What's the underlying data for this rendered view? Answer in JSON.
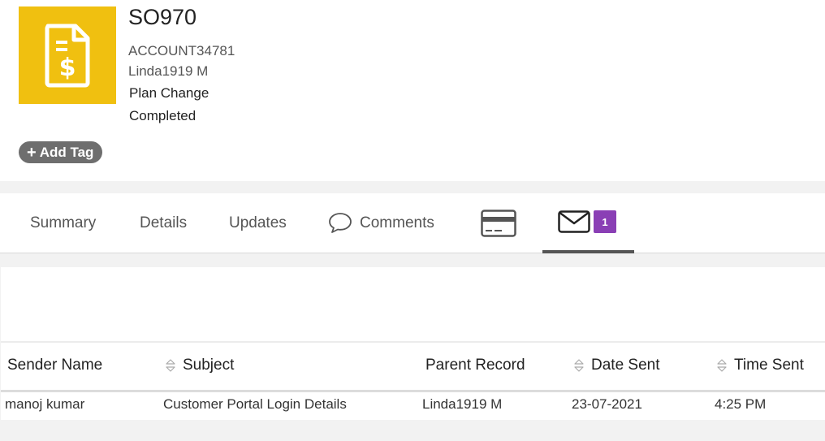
{
  "record": {
    "icon": "invoice-dollar-icon",
    "id": "SO970",
    "account": "ACCOUNT34781",
    "contact": "Linda1919 M",
    "type": "Plan Change",
    "status": "Completed",
    "add_tag_label": "Add Tag",
    "brand_color": "#f0c010"
  },
  "tabs": {
    "summary": "Summary",
    "details": "Details",
    "updates": "Updates",
    "comments": "Comments",
    "billing_icon": "credit-card-icon",
    "email_icon": "envelope-icon",
    "email_badge": "1",
    "badge_color": "#8a3fb5"
  },
  "table": {
    "headers": {
      "sender": "Sender Name",
      "subject": "Subject",
      "parent": "Parent Record",
      "date": "Date Sent",
      "time": "Time Sent"
    },
    "rows": [
      {
        "sender": "manoj kumar",
        "subject": "Customer Portal Login Details",
        "parent": "Linda1919 M",
        "date": "23-07-2021",
        "time": "4:25 PM"
      }
    ]
  }
}
